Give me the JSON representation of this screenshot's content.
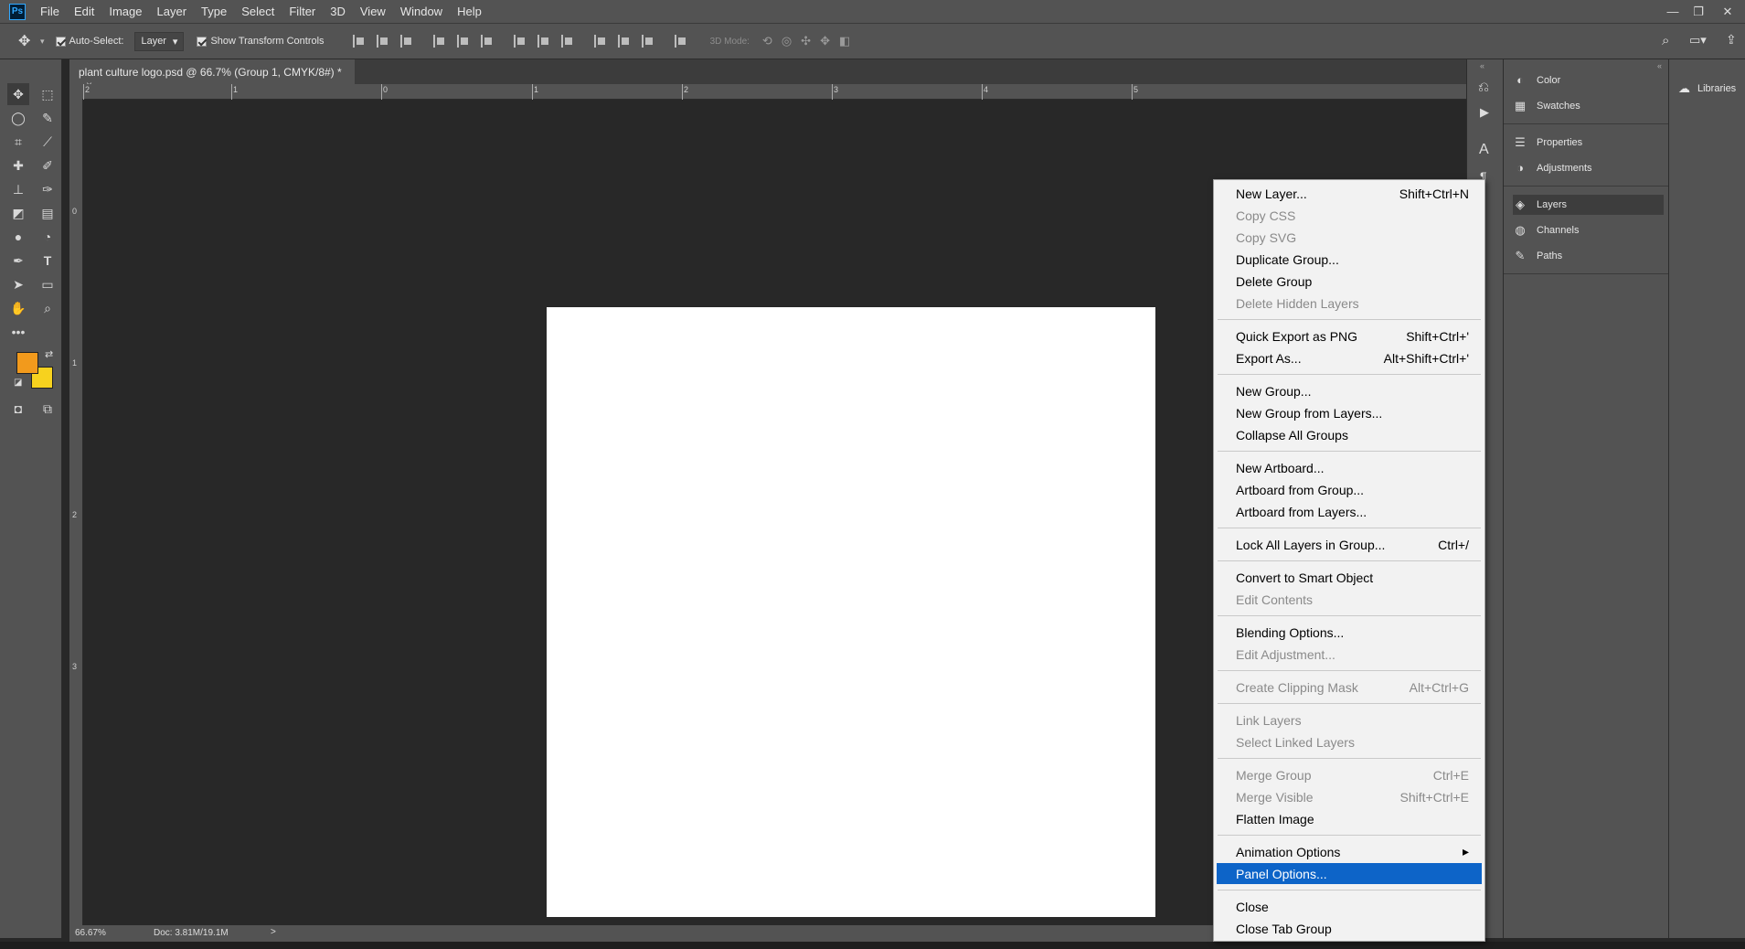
{
  "menubar": {
    "app_icon": "Ps",
    "items": [
      "File",
      "Edit",
      "Image",
      "Layer",
      "Type",
      "Select",
      "Filter",
      "3D",
      "View",
      "Window",
      "Help"
    ]
  },
  "options": {
    "auto_select_label": "Auto-Select:",
    "auto_select_target": "Layer",
    "show_transform_label": "Show Transform Controls",
    "mode_3d_label": "3D Mode:"
  },
  "document": {
    "tab_title": "plant culture logo.psd @ 66.7% (Group 1, CMYK/8#) *",
    "tab_close": "×"
  },
  "rulers": {
    "h_labels": [
      "2",
      "1",
      "0",
      "1",
      "2",
      "3",
      "4",
      "5"
    ],
    "v_labels": [
      "0",
      "1",
      "2",
      "3"
    ]
  },
  "status": {
    "zoom": "66.67%",
    "doc_info": "Doc: 3.81M/19.1M",
    "arrow": ">"
  },
  "colors": {
    "foreground": "#f29a1c",
    "background": "#f7d21e",
    "highlight": "#0d64c8"
  },
  "panels": {
    "groups": [
      [
        {
          "icon": "palette-icon",
          "glyph": "◐",
          "label": "Color"
        },
        {
          "icon": "swatches-icon",
          "glyph": "▦",
          "label": "Swatches"
        }
      ],
      [
        {
          "icon": "properties-icon",
          "glyph": "☰",
          "label": "Properties"
        },
        {
          "icon": "adjustments-icon",
          "glyph": "◑",
          "label": "Adjustments"
        }
      ],
      [
        {
          "icon": "layers-icon",
          "glyph": "◈",
          "label": "Layers"
        },
        {
          "icon": "channels-icon",
          "glyph": "◍",
          "label": "Channels"
        },
        {
          "icon": "paths-icon",
          "glyph": "✎",
          "label": "Paths"
        }
      ]
    ],
    "libraries_label": "Libraries"
  },
  "context_menu": {
    "items": [
      {
        "label": "New Layer...",
        "shortcut": "Shift+Ctrl+N",
        "disabled": false
      },
      {
        "label": "Copy CSS",
        "shortcut": "",
        "disabled": true
      },
      {
        "label": "Copy SVG",
        "shortcut": "",
        "disabled": true
      },
      {
        "label": "Duplicate Group...",
        "shortcut": "",
        "disabled": false
      },
      {
        "label": "Delete Group",
        "shortcut": "",
        "disabled": false
      },
      {
        "label": "Delete Hidden Layers",
        "shortcut": "",
        "disabled": true
      },
      {
        "sep": true
      },
      {
        "label": "Quick Export as PNG",
        "shortcut": "Shift+Ctrl+'",
        "disabled": false
      },
      {
        "label": "Export As...",
        "shortcut": "Alt+Shift+Ctrl+'",
        "disabled": false
      },
      {
        "sep": true
      },
      {
        "label": "New Group...",
        "shortcut": "",
        "disabled": false
      },
      {
        "label": "New Group from Layers...",
        "shortcut": "",
        "disabled": false
      },
      {
        "label": "Collapse All Groups",
        "shortcut": "",
        "disabled": false
      },
      {
        "sep": true
      },
      {
        "label": "New Artboard...",
        "shortcut": "",
        "disabled": false
      },
      {
        "label": "Artboard from Group...",
        "shortcut": "",
        "disabled": false
      },
      {
        "label": "Artboard from Layers...",
        "shortcut": "",
        "disabled": false
      },
      {
        "sep": true
      },
      {
        "label": "Lock All Layers in Group...",
        "shortcut": "Ctrl+/",
        "disabled": false
      },
      {
        "sep": true
      },
      {
        "label": "Convert to Smart Object",
        "shortcut": "",
        "disabled": false
      },
      {
        "label": "Edit Contents",
        "shortcut": "",
        "disabled": true
      },
      {
        "sep": true
      },
      {
        "label": "Blending Options...",
        "shortcut": "",
        "disabled": false
      },
      {
        "label": "Edit Adjustment...",
        "shortcut": "",
        "disabled": true
      },
      {
        "sep": true
      },
      {
        "label": "Create Clipping Mask",
        "shortcut": "Alt+Ctrl+G",
        "disabled": true
      },
      {
        "sep": true
      },
      {
        "label": "Link Layers",
        "shortcut": "",
        "disabled": true
      },
      {
        "label": "Select Linked Layers",
        "shortcut": "",
        "disabled": true
      },
      {
        "sep": true
      },
      {
        "label": "Merge Group",
        "shortcut": "Ctrl+E",
        "disabled": true
      },
      {
        "label": "Merge Visible",
        "shortcut": "Shift+Ctrl+E",
        "disabled": true
      },
      {
        "label": "Flatten Image",
        "shortcut": "",
        "disabled": false
      },
      {
        "sep": true
      },
      {
        "label": "Animation Options",
        "shortcut": "▸",
        "disabled": false
      },
      {
        "label": "Panel Options...",
        "shortcut": "",
        "disabled": false,
        "highlight": true
      },
      {
        "sep": true
      },
      {
        "label": "Close",
        "shortcut": "",
        "disabled": false
      },
      {
        "label": "Close Tab Group",
        "shortcut": "",
        "disabled": false
      }
    ]
  }
}
